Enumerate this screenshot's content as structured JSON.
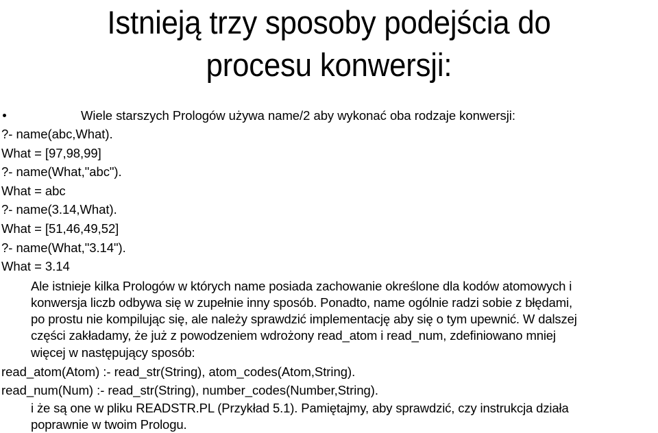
{
  "slide": {
    "background_color": "#ffffff",
    "text_color": "#000000",
    "title": {
      "line1": "Istnieją trzy sposoby podejścia do",
      "line2": "procesu konwersji:"
    },
    "bullet": {
      "glyph": "bullet-dot",
      "text": "Wiele starszych Prologów używa name/2 aby wykonać oba rodzaje konwersji:"
    },
    "code_block": [
      "?- name(abc,What).",
      "What = [97,98,99]",
      "?- name(What,\"abc\").",
      "What = abc",
      "?- name(3.14,What).",
      "What = [51,46,49,52]",
      "?- name(What,\"3.14\").",
      "What = 3.14"
    ],
    "paragraph_lines": [
      "Ale istnieje kilka Prologów w których name posiada zachowanie określone dla kodów atomowych i",
      "konwersja liczb odbywa się w zupełnie inny sposób. Ponadto, name ogólnie radzi sobie z błędami,",
      "po prostu nie kompilując się, ale należy sprawdzić implementację aby się o tym upewnić. W dalszej",
      "części zakładamy, że już z powodzeniem wdrożony read_atom i read_num, zdefiniowano mniej",
      "więcej w następujący sposób:"
    ],
    "predicates": [
      "read_atom(Atom) :- read_str(String), atom_codes(Atom,String).",
      "read_num(Num) :- read_str(String), number_codes(Number,String)."
    ],
    "closing_lines": [
      "i że są one w pliku READSTR.PL (Przykład 5.1). Pamiętajmy, aby sprawdzić, czy instrukcja działa",
      "poprawnie w twoim Prologu."
    ]
  }
}
